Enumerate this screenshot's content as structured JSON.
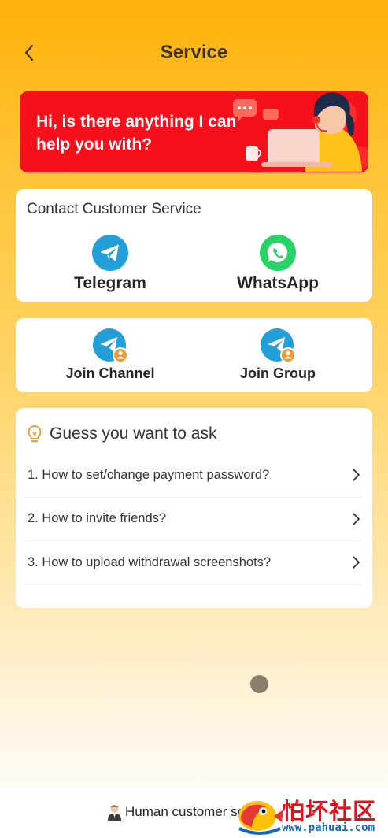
{
  "header": {
    "title": "Service"
  },
  "banner": {
    "text": "Hi, is there anything I can help you with?"
  },
  "contact": {
    "title": "Contact Customer Service",
    "items": [
      {
        "label": "Telegram",
        "icon": "telegram-icon",
        "color": "#229ED9"
      },
      {
        "label": "WhatsApp",
        "icon": "whatsapp-icon",
        "color": "#25D366"
      }
    ]
  },
  "join": {
    "items": [
      {
        "label": "Join Channel",
        "icon": "telegram-channel-icon"
      },
      {
        "label": "Join Group",
        "icon": "telegram-group-icon"
      }
    ]
  },
  "faq": {
    "title": "Guess you want to ask",
    "items": [
      "1. How to set/change payment password?",
      "2. How to invite friends?",
      "3. How to upload withdrawal screenshots?"
    ]
  },
  "footer": {
    "human_label": "Human customer service"
  },
  "watermark": {
    "text": "怕坏社区",
    "url": "www.pahuai.com"
  },
  "colors": {
    "accent": "#FFB10B",
    "banner": "#F5101B",
    "telegram": "#229ED9",
    "whatsapp": "#25D366"
  }
}
